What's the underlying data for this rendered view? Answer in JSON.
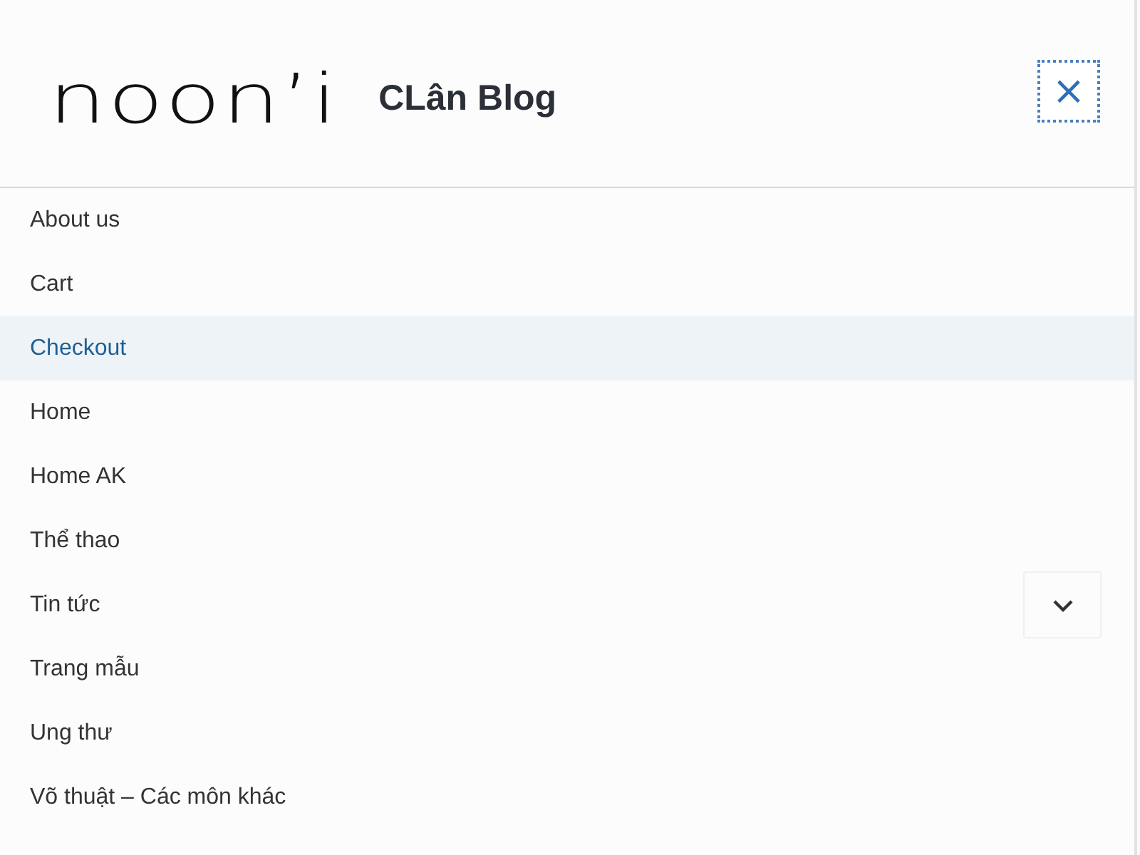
{
  "header": {
    "logo": "noon’i",
    "site_title": "CLân Blog",
    "close_button": "×"
  },
  "menu": [
    {
      "label": "About us",
      "selected": false,
      "expandable": false
    },
    {
      "label": "Cart",
      "selected": false,
      "expandable": false
    },
    {
      "label": "Checkout",
      "selected": true,
      "expandable": false
    },
    {
      "label": "Home",
      "selected": false,
      "expandable": false
    },
    {
      "label": "Home AK",
      "selected": false,
      "expandable": false
    },
    {
      "label": "Thể thao",
      "selected": false,
      "expandable": false
    },
    {
      "label": "Tin tức",
      "selected": false,
      "expandable": true
    },
    {
      "label": "Trang mẫu",
      "selected": false,
      "expandable": false
    },
    {
      "label": "Ung thư",
      "selected": false,
      "expandable": false
    },
    {
      "label": "Võ thuật – Các môn khác",
      "selected": false,
      "expandable": false
    }
  ]
}
